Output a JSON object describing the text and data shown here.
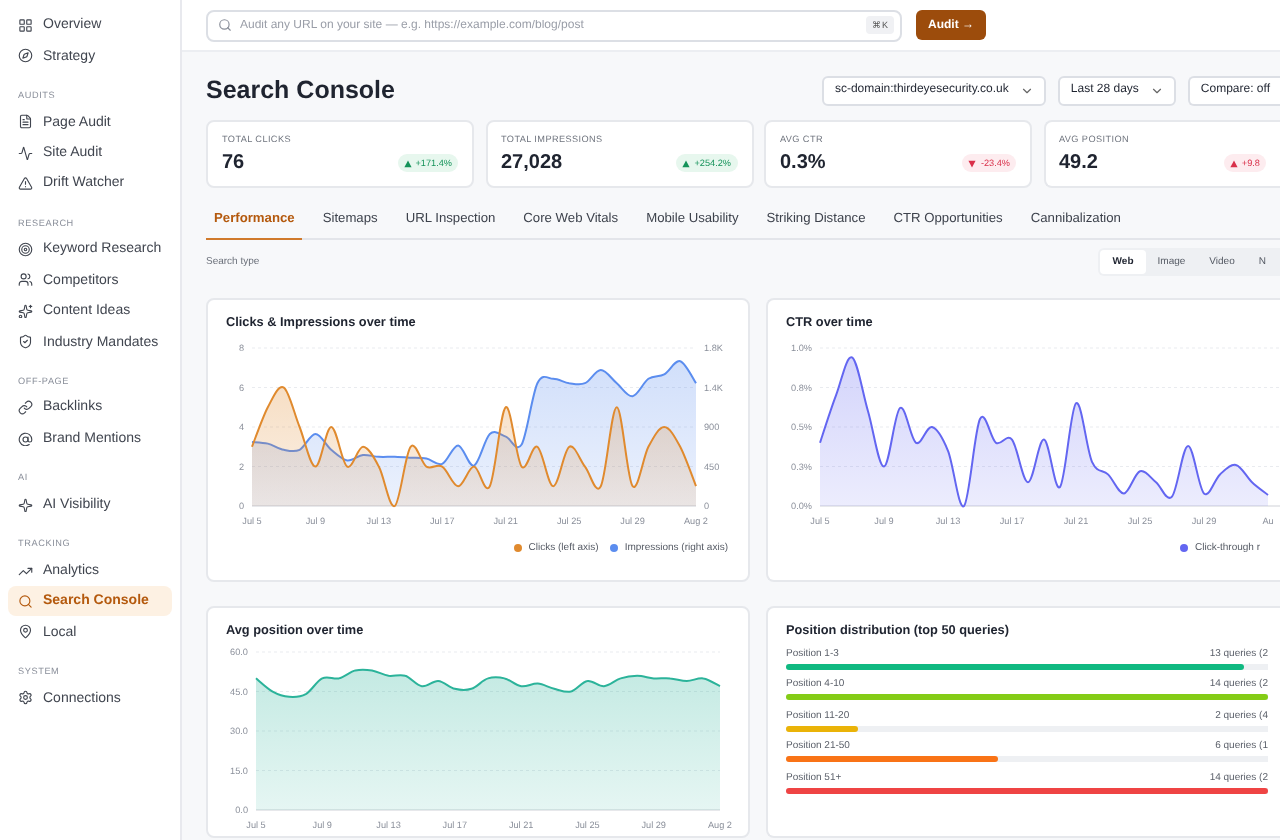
{
  "sidebar": {
    "sections": [
      {
        "items": [
          {
            "label": "Overview",
            "selected": false
          },
          {
            "label": "Strategy",
            "selected": false
          }
        ]
      },
      {
        "label": "AUDITS",
        "items": [
          {
            "label": "Page Audit",
            "selected": false
          },
          {
            "label": "Site Audit",
            "selected": false
          },
          {
            "label": "Drift Watcher",
            "selected": false
          }
        ]
      },
      {
        "label": "RESEARCH",
        "items": [
          {
            "label": "Keyword Research",
            "selected": false
          },
          {
            "label": "Competitors",
            "selected": false
          },
          {
            "label": "Content Ideas",
            "selected": false
          },
          {
            "label": "Industry Mandates",
            "selected": false
          }
        ]
      },
      {
        "label": "OFF-PAGE",
        "items": [
          {
            "label": "Backlinks",
            "selected": false
          },
          {
            "label": "Brand Mentions",
            "selected": false
          }
        ]
      },
      {
        "label": "AI",
        "items": [
          {
            "label": "AI Visibility",
            "selected": false
          }
        ]
      },
      {
        "label": "TRACKING",
        "items": [
          {
            "label": "Analytics",
            "selected": false
          },
          {
            "label": "Search Console",
            "selected": true
          },
          {
            "label": "Local",
            "selected": false
          }
        ]
      },
      {
        "label": "SYSTEM",
        "items": [
          {
            "label": "Connections",
            "selected": false
          }
        ]
      }
    ]
  },
  "topbar": {
    "search": {
      "placeholder": "Audit any URL on your site — e.g. https://example.com/blog/post",
      "shortcut": "⌘K"
    },
    "button": "Audit →"
  },
  "header": {
    "title": "Search Console",
    "selects": [
      "sc-domain:thirdeyesecurity.co.uk",
      "Last 28 days",
      "Compare: off"
    ]
  },
  "stats": [
    {
      "label": "TOTAL CLICKS",
      "value": "76",
      "delta": "+171.4%",
      "up": true,
      "positive": true
    },
    {
      "label": "TOTAL IMPRESSIONS",
      "value": "27,028",
      "delta": "+254.2%",
      "up": true,
      "positive": true
    },
    {
      "label": "AVG CTR",
      "value": "0.3%",
      "delta": "-23.4%",
      "up": false,
      "positive": false
    },
    {
      "label": "AVG POSITION",
      "value": "49.2",
      "delta": "+9.8",
      "up": true,
      "positive": false
    }
  ],
  "tabs": [
    {
      "label": "Performance",
      "selected": true
    },
    {
      "label": "Sitemaps",
      "selected": false
    },
    {
      "label": "URL Inspection",
      "selected": false
    },
    {
      "label": "Core Web Vitals",
      "selected": false
    },
    {
      "label": "Mobile Usability",
      "selected": false
    },
    {
      "label": "Striking Distance",
      "selected": false
    },
    {
      "label": "CTR Opportunities",
      "selected": false
    },
    {
      "label": "Cannibalization",
      "selected": false
    }
  ],
  "search_type": {
    "label": "Search type",
    "options": [
      {
        "label": "Web",
        "selected": true
      },
      {
        "label": "Image",
        "selected": false
      },
      {
        "label": "Video",
        "selected": false
      },
      {
        "label": "N",
        "selected": false
      }
    ]
  },
  "charts": [
    {
      "title": "Clicks & Impressions over time",
      "chart_data": {
        "type": "area",
        "categories": [
          "Jul 5",
          null,
          null,
          null,
          "Jul 9",
          null,
          null,
          null,
          "Jul 13",
          null,
          null,
          null,
          "Jul 17",
          null,
          null,
          null,
          "Jul 21",
          null,
          null,
          null,
          "Jul 25",
          null,
          null,
          null,
          "Jul 29",
          null,
          null,
          null,
          "Aug 2"
        ],
        "grid": true,
        "ylim": [
          0,
          8
        ],
        "yticks": [
          {
            "value": 0,
            "label": "0"
          },
          {
            "value": 2,
            "label": "2"
          },
          {
            "value": 4,
            "label": "4"
          },
          {
            "value": 6,
            "label": "6"
          },
          {
            "value": 8,
            "label": "8"
          }
        ],
        "y2lim": [
          0,
          1800
        ],
        "y2ticks": [
          {
            "value": 0,
            "label": "0"
          },
          {
            "value": 450,
            "label": "450"
          },
          {
            "value": 900,
            "label": "900"
          },
          {
            "value": 1350,
            "label": "1.4K"
          },
          {
            "value": 1800,
            "label": "1.8K"
          }
        ],
        "series": [
          {
            "name": "Clicks (left axis)",
            "color": "#e08a2e",
            "values": [
              3,
              5,
              6,
              4,
              2,
              4,
              2,
              3,
              2,
              0,
              3,
              2,
              2,
              1,
              2,
              1,
              5,
              2,
              3,
              1,
              3,
              2,
              1,
              5,
              1,
              3,
              4,
              3,
              1
            ]
          },
          {
            "name": "Impressions (right axis)",
            "color": "#5b8def",
            "axis": "y2",
            "values": [
              730,
              710,
              640,
              640,
              820,
              640,
              520,
              580,
              560,
              560,
              550,
              540,
              480,
              690,
              460,
              820,
              790,
              700,
              1400,
              1450,
              1400,
              1400,
              1550,
              1400,
              1250,
              1450,
              1500,
              1650,
              1400
            ]
          }
        ]
      }
    },
    {
      "title": "CTR over time",
      "chart_data": {
        "type": "area",
        "categories": [
          "Jul 5",
          null,
          null,
          null,
          "Jul 9",
          null,
          null,
          null,
          "Jul 13",
          null,
          null,
          null,
          "Jul 17",
          null,
          null,
          null,
          "Jul 21",
          null,
          null,
          null,
          "Jul 25",
          null,
          null,
          null,
          "Jul 29",
          null,
          null,
          null,
          "Au"
        ],
        "grid": true,
        "ylim": [
          0,
          1
        ],
        "yticks": [
          {
            "value": 0,
            "label": "0.0%"
          },
          {
            "value": 0.25,
            "label": "0.3%"
          },
          {
            "value": 0.5,
            "label": "0.5%"
          },
          {
            "value": 0.75,
            "label": "0.8%"
          },
          {
            "value": 1,
            "label": "1.0%"
          }
        ],
        "series": [
          {
            "name": "Click-through r",
            "color": "#6366f1",
            "values": [
              0.4,
              0.7,
              0.94,
              0.6,
              0.25,
              0.62,
              0.4,
              0.5,
              0.35,
              0.0,
              0.55,
              0.4,
              0.42,
              0.15,
              0.42,
              0.12,
              0.65,
              0.28,
              0.2,
              0.08,
              0.22,
              0.15,
              0.06,
              0.38,
              0.08,
              0.2,
              0.26,
              0.15,
              0.07
            ]
          }
        ]
      }
    },
    {
      "title": "Avg position over time",
      "chart_data": {
        "type": "area",
        "categories": [
          "Jul 5",
          null,
          null,
          null,
          "Jul 9",
          null,
          null,
          null,
          "Jul 13",
          null,
          null,
          null,
          "Jul 17",
          null,
          null,
          null,
          "Jul 21",
          null,
          null,
          null,
          "Jul 25",
          null,
          null,
          null,
          "Jul 29",
          null,
          null,
          null,
          "Aug 2"
        ],
        "grid": true,
        "ylim": [
          0,
          60
        ],
        "yticks": [
          {
            "value": 0,
            "label": "0.0"
          },
          {
            "value": 15,
            "label": "15.0"
          },
          {
            "value": 30,
            "label": "30.0"
          },
          {
            "value": 45,
            "label": "45.0"
          },
          {
            "value": 60,
            "label": "60.0"
          }
        ],
        "series": [
          {
            "color": "#2bb39a",
            "values": [
              50,
              45,
              43,
              44,
              50,
              50,
              53,
              53,
              51,
              51,
              47,
              49,
              46,
              46,
              50,
              50,
              47,
              48,
              46,
              45,
              49,
              47,
              50,
              51,
              50,
              50,
              49,
              50,
              47
            ]
          }
        ]
      }
    }
  ],
  "distribution": {
    "title": "Position distribution (top 50 queries)",
    "rows": [
      {
        "label": "Position 1-3",
        "count": "13 queries (2",
        "level": 0.95,
        "color": "#10b981"
      },
      {
        "label": "Position 4-10",
        "count": "14 queries (2",
        "level": 1.0,
        "color": "#84cc16"
      },
      {
        "label": "Position 11-20",
        "count": "2 queries (4",
        "level": 0.15,
        "color": "#eab308"
      },
      {
        "label": "Position 21-50",
        "count": "6 queries (1",
        "level": 0.44,
        "color": "#f97316"
      },
      {
        "label": "Position 51+",
        "count": "14 queries (2",
        "level": 1.0,
        "color": "#ef4444"
      }
    ]
  }
}
